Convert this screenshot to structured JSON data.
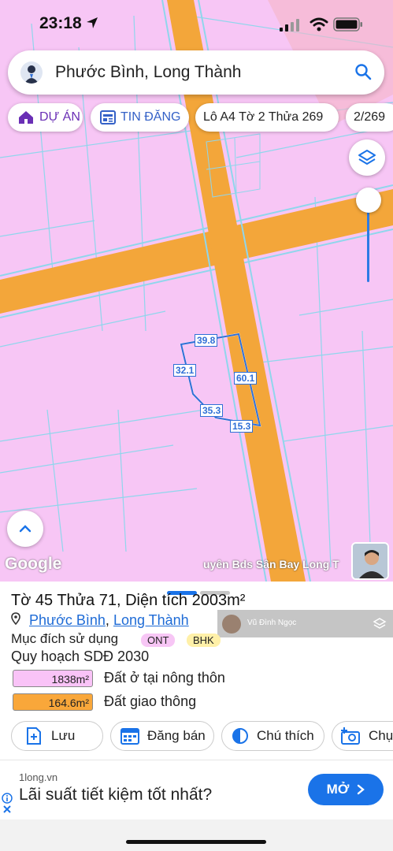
{
  "status_bar": {
    "time": "23:18"
  },
  "search": {
    "query": "Phước Bình, Long Thành"
  },
  "chips": [
    {
      "label": "DỰ ÁN"
    },
    {
      "label": "TIN ĐĂNG"
    },
    {
      "label": "Lô A4 Tờ 2 Thửa 269"
    },
    {
      "label": "2/269"
    }
  ],
  "map": {
    "dimension_labels": [
      "39.8",
      "32.1",
      "60.1",
      "35.3",
      "15.3"
    ],
    "google_logo": "Google",
    "agent_overlay": "uyên Bds Sân Bay Long T"
  },
  "parcel": {
    "title": "Tờ 45 Thửa 71, Diện tích 2003m²",
    "ward": "Phước Bình",
    "separator": ", ",
    "district": "Long Thành",
    "purpose_label": "Mục đích sử dụng",
    "tags": [
      {
        "code": "ONT",
        "color": "#f7c6f5"
      },
      {
        "code": "BHK",
        "color": "#fff0a8"
      }
    ],
    "plan_title": "Quy hoạch SDĐ 2030",
    "areas": [
      {
        "value": "1838m²",
        "label": "Đất ở tại nông thôn",
        "color": "#f9c3f7"
      },
      {
        "value": "164.6m²",
        "label": "Đất giao thông",
        "color": "#f9a73a"
      }
    ]
  },
  "overlay_banner": {
    "name": "Vũ Đình Ngọc"
  },
  "actions": [
    {
      "label": "Lưu"
    },
    {
      "label": "Đăng bán"
    },
    {
      "label": "Chú thích"
    },
    {
      "label": "Chụ"
    }
  ],
  "ad": {
    "source": "1long.vn",
    "headline": "Lãi suất tiết kiệm tốt nhất?",
    "cta": "MỞ"
  },
  "colors": {
    "land_pink": "#f7c6f5",
    "road_orange": "#f9a73a",
    "accent_blue": "#1a73e8",
    "label_blue": "#2f6fd6"
  }
}
